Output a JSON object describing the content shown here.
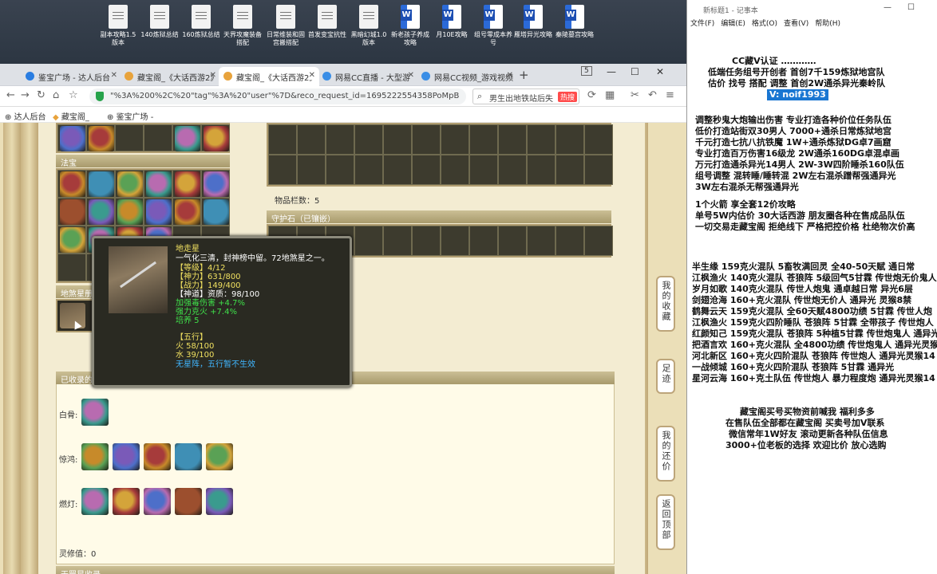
{
  "desktop": {
    "icons": [
      {
        "label": "副本攻略1.5版本",
        "type": "txt"
      },
      {
        "label": "140炼狱总结",
        "type": "txt"
      },
      {
        "label": "160炼狱总结",
        "type": "txt"
      },
      {
        "label": "天界攻魔装备搭配",
        "type": "txt"
      },
      {
        "label": "日常维装和固宫搬搭配",
        "type": "txt"
      },
      {
        "label": "首发变宝抗性",
        "type": "txt"
      },
      {
        "label": "黑暗幻城1.0版本",
        "type": "txt"
      },
      {
        "label": "新老孩子养成攻略",
        "type": "doc"
      },
      {
        "label": "月10E攻略",
        "type": "doc"
      },
      {
        "label": "组号零成本养号",
        "type": "doc"
      },
      {
        "label": "雁塔异光攻略",
        "type": "doc"
      },
      {
        "label": "秦陵墓宫攻略",
        "type": "doc"
      }
    ]
  },
  "browser": {
    "tabs": [
      {
        "label": "鉴宝广场 - 达人后台",
        "color": "#2a7de1"
      },
      {
        "label": "藏宝阁_《大话西游2》",
        "color": "#e8a33c"
      },
      {
        "label": "藏宝阁_《大话西游2》",
        "color": "#e8a33c",
        "active": true
      },
      {
        "label": "网易CC直播 - 大型游",
        "color": "#3a8ee6"
      },
      {
        "label": "网易CC视频_游戏视频",
        "color": "#3a8ee6"
      }
    ],
    "tab_count": "5",
    "url": "\"%3A%200%2C%20\"tag\"%3A%20\"user\"%7D&reco_request_id=1695222554358PoMpB",
    "search_text": "男生出地铁站后失",
    "search_hot": "热搜",
    "bookmarks": [
      "达人后台",
      "藏宝阁_",
      "鉴宝广场 -"
    ]
  },
  "game": {
    "fabao_title": "法宝",
    "dishaxing_title": "地煞星册",
    "item_count_label": "物品栏数：5",
    "guardian_title": "守护石（已镶嵌）",
    "collected_title": "已收录的",
    "rows": [
      {
        "label": "白骨:"
      },
      {
        "label": "惊鸿:"
      },
      {
        "label": "燃灯:"
      }
    ],
    "lingxiu": "灵修值：0",
    "bottom_title": "天罡星收录",
    "side_buttons": [
      "我的收藏",
      "足迹",
      "我的还价",
      "返回顶部"
    ]
  },
  "tooltip": {
    "name": "地走星",
    "desc": "一气化三清，封神榜中留。72地煞星之一。",
    "level": "【等级】4/12",
    "shenli": "【神力】631/800",
    "zhanli": "【战力】149/400",
    "shendao": "【神道】资质：98/100",
    "bonus1": "加强毒伤害 +4.7%",
    "bonus2": "强力克火 +7.4%",
    "peiyang": "培养 5",
    "wuxing_title": "【五行】",
    "fire": "火 58/100",
    "water": "水 39/100",
    "no_formation": "无星阵，五行暂不生效"
  },
  "notepad": {
    "title": "新标题1 - 记事本",
    "menu": [
      "文件(F)",
      "编辑(E)",
      "格式(O)",
      "查看(V)",
      "帮助(H)"
    ],
    "lines": [
      "CC藏V认证 …………",
      "低端任务组号开创者          首创7千159炼狱地宫队",
      "估价 找号 搭配 调整         首创2W通杀异光秦岭队",
      "V:  noif1993",
      "调整秒鬼大炮输出伤害         专业打造各种价位任务队伍",
      "低价打造站街双30男人            7000+通杀日常炼狱地宫",
      "千元打造七抗八抗铁魔            1W+通杀炼狱DG卓7画窟",
      "专业打造百万伤害16级龙          2W通杀160DG卓混卓画",
      "万元打造通杀异光14男人        2W-3W四阶睡杀160队伍",
      "组号调整 混转睡/睡转混           2W左右混杀蹭帮强通异光",
      "                                  3W左右混杀无帮强通异光",
      "1个火箭 享全套12价攻略",
      "单号5W内估价 30大话西游         朋友圈各种在售成品队伍",
      "一切交易走藏宝阁 拒绝线下    严格把控价格 杜绝物次价高",
      "半生缘    159克火混队 5畜牧满回灵 全40-50天赋 通日常",
      "江枫渔火 140克火混队 苍狼阵 5级回气5甘霖 传世炮无价鬼人",
      "岁月如歌 140克火混队 传世人炮鬼 通卓越日常 异光6层",
      "剑翅沧海 160+克火混队 传世炮无价人 通异光 灵猴8禁",
      "鹤舞云天 159克火混队 全60天赋4800功绩 5甘霖 传世人炮",
      "江枫渔火 159克火四阶睡队 苍狼阵 5甘霖 全带孩子 传世炮人",
      "红颜知己 159克火混队 苍狼阵 5种植5甘霖 传世炮鬼人 通异光",
      "把酒言欢 160+克火混队 全4800功绩 传世炮鬼人 通异光灵猴",
      "河北新区 160+克火四阶混队 苍狼阵 传世炮人 通异光灵猴14",
      "一战倾城 160+克火四阶混队 苍狼阵 5甘霖 通异光",
      "星河云海 160+克土队伍 传世炮人 暴力程度炮 通异光灵猴14",
      "藏宝阁买号买物资前喊我 福利多多",
      "在售队伍全部都在藏宝阁 买卖号加V联系",
      "微信常年1W好友 滚动更新各种队伍信息",
      "3000+位老板的选择 欢迎比价 放心选购"
    ],
    "highlight": "V:  noif1993"
  }
}
